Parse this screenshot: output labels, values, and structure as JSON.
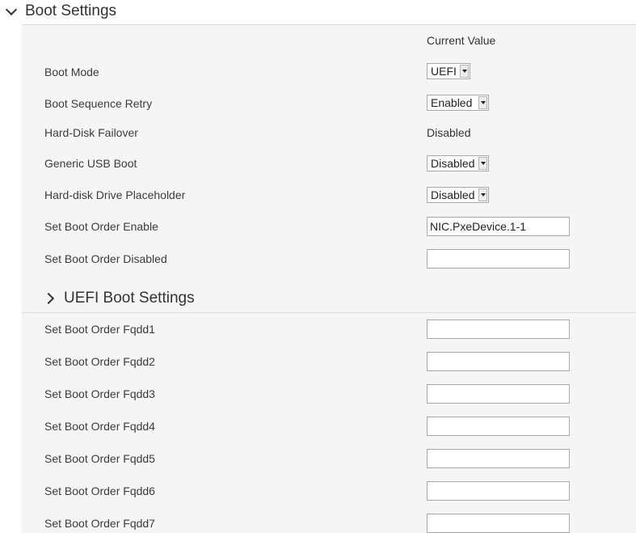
{
  "boot_settings": {
    "title": "Boot Settings",
    "column_header": "Current Value",
    "rows": [
      {
        "label": "Boot Mode",
        "type": "select",
        "value": "UEFI"
      },
      {
        "label": "Boot Sequence Retry",
        "type": "select",
        "value": "Enabled"
      },
      {
        "label": "Hard-Disk Failover",
        "type": "text",
        "value": "Disabled"
      },
      {
        "label": "Generic USB Boot",
        "type": "select",
        "value": "Disabled"
      },
      {
        "label": "Hard-disk Drive Placeholder",
        "type": "select",
        "value": "Disabled"
      },
      {
        "label": "Set Boot Order Enable",
        "type": "input",
        "value": "NIC.PxeDevice.1-1"
      },
      {
        "label": "Set Boot Order Disabled",
        "type": "input",
        "value": ""
      }
    ]
  },
  "uefi_boot_settings": {
    "title": "UEFI Boot Settings",
    "rows": [
      {
        "label": "Set Boot Order Fqdd1",
        "value": ""
      },
      {
        "label": "Set Boot Order Fqdd2",
        "value": ""
      },
      {
        "label": "Set Boot Order Fqdd3",
        "value": ""
      },
      {
        "label": "Set Boot Order Fqdd4",
        "value": ""
      },
      {
        "label": "Set Boot Order Fqdd5",
        "value": ""
      },
      {
        "label": "Set Boot Order Fqdd6",
        "value": ""
      },
      {
        "label": "Set Boot Order Fqdd7",
        "value": ""
      }
    ]
  },
  "icons": {
    "section_toggle": "chevron-down-icon",
    "subsection_toggle": "chevron-right-icon",
    "dropdown": "caret-down-icon"
  }
}
